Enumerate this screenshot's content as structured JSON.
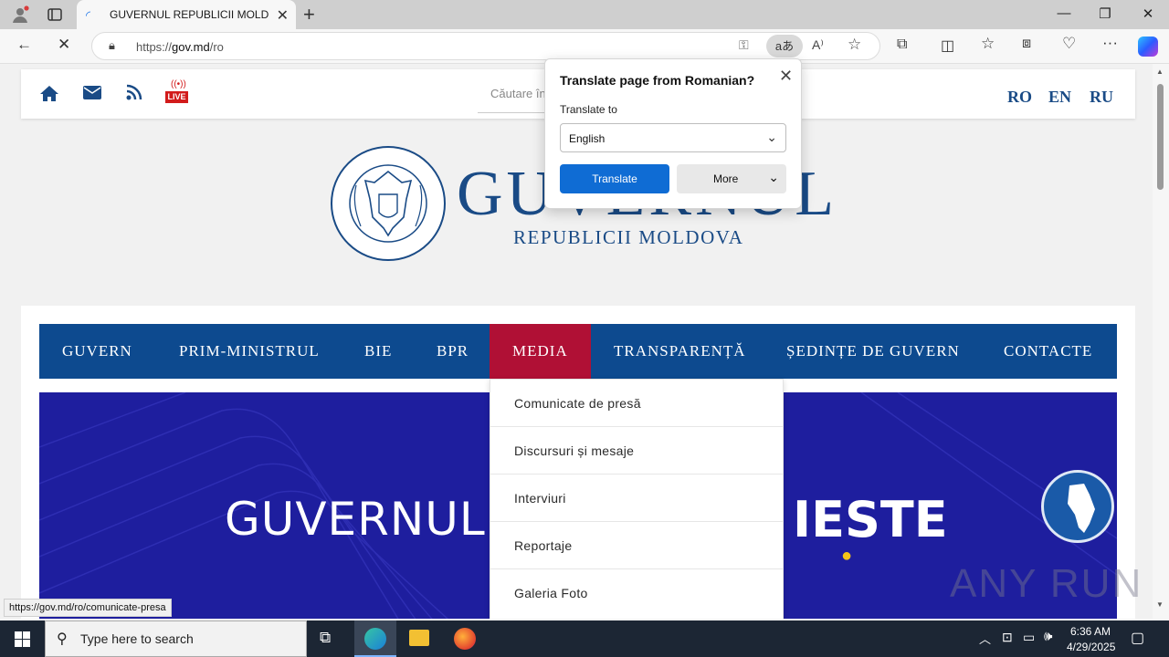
{
  "browser": {
    "tab_title": "GUVERNUL REPUBLICII MOLDOV",
    "url_prefix": "https://",
    "url_host": "gov.md",
    "url_path": "/ro",
    "status_link": "https://gov.md/ro/comunicate-presa"
  },
  "site": {
    "search_placeholder": "Căutare în",
    "languages": [
      "RO",
      "EN",
      "RU"
    ],
    "live_label": "LIVE",
    "logo_title": "GUVERNUL",
    "logo_subtitle": "REPUBLICII MOLDOVA",
    "seal_text": "GUVERNUL REPUBLICII MOLDOVA",
    "menu": [
      "GUVERN",
      "PRIM-MINISTRUL",
      "BIE",
      "BPR",
      "MEDIA",
      "TRANSPARENȚĂ",
      "ȘEDINȚE DE GUVERN",
      "CONTACTE"
    ],
    "active_menu": "MEDIA",
    "media_submenu": [
      "Comunicate de presă",
      "Discursuri și mesaje",
      "Interviuri",
      "Reportaje",
      "Galeria Foto"
    ],
    "hero_left": "GUVERNUL",
    "hero_right": "IESTE",
    "watermark": "ANY RUN"
  },
  "translate_popup": {
    "title": "Translate page from Romanian?",
    "label": "Translate to",
    "selected_language": "English",
    "translate_button": "Translate",
    "more_button": "More"
  },
  "taskbar": {
    "search_placeholder": "Type here to search",
    "time": "6:36 AM",
    "date": "4/29/2025"
  },
  "colors": {
    "brand_blue": "#0d4a8f",
    "active_red": "#b01035",
    "hero_blue": "#1e1e9e",
    "edge_blue": "#0f6cd4"
  }
}
